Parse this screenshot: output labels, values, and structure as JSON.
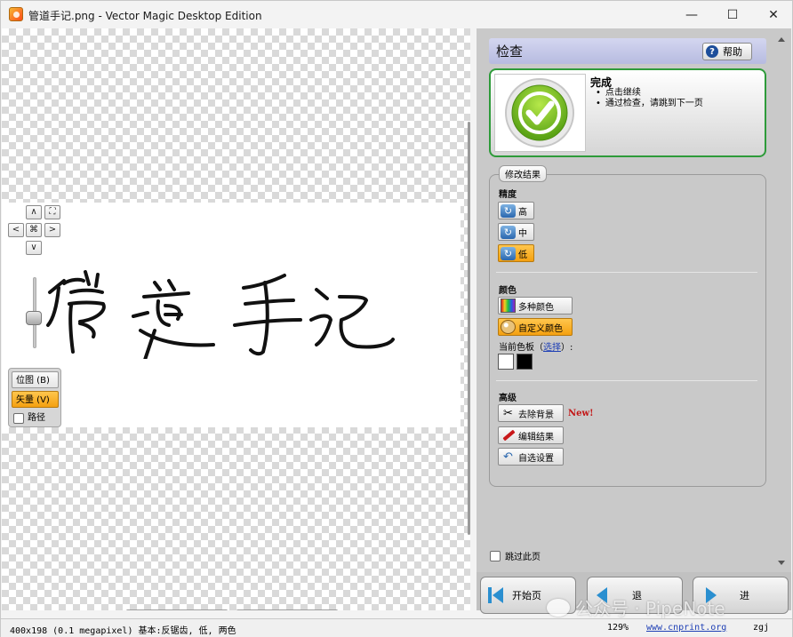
{
  "window": {
    "title": "管道手记.png - Vector Magic Desktop Edition",
    "minimize": "—",
    "maximize": "☐",
    "close": "✕"
  },
  "canvas": {
    "nav": {
      "up": "∧",
      "down": "∨",
      "left": "<",
      "right": ">",
      "center": "⌘",
      "fit": "⛶"
    },
    "view": {
      "bitmap": "位图 (B)",
      "vector": "矢量 (V)",
      "paths": "路径"
    }
  },
  "panel": {
    "title": "检查",
    "help": "帮助",
    "done": {
      "title": "完成",
      "bullets": [
        "点击继续",
        "通过检查，请跳到下一页"
      ]
    },
    "group_title": "修改结果",
    "precision": {
      "label": "精度",
      "high": "高",
      "medium": "中",
      "low": "低",
      "selected": "低"
    },
    "color": {
      "label": "颜色",
      "multi": "多种颜色",
      "custom": "自定义颜色",
      "palette_label": "当前色板",
      "palette_link": "选择",
      "palette_open": "（",
      "palette_close": "）:",
      "swatches": [
        "#ffffff",
        "#000000"
      ]
    },
    "advanced": {
      "label": "高级",
      "remove_bg": "去除背景",
      "new_badge": "New!",
      "edit_result": "编辑结果",
      "custom_settings": "自选设置"
    },
    "skip_page": "跳过此页",
    "nav": {
      "home": "开始页",
      "back": "退",
      "next": "进"
    }
  },
  "watermark": "公众号 · PipeNote",
  "status": {
    "info": "400x198 (0.1 megapixel)  基本:反锯齿, 低, 两色",
    "zoom": "129%",
    "link": "www.cnprint.org",
    "user": "zgj"
  },
  "colors": {
    "accent_orange": "#f4a010",
    "done_green": "#2e9b3a",
    "header_blue": "#b7bbe0",
    "arrow_blue": "#2a8fd0"
  }
}
